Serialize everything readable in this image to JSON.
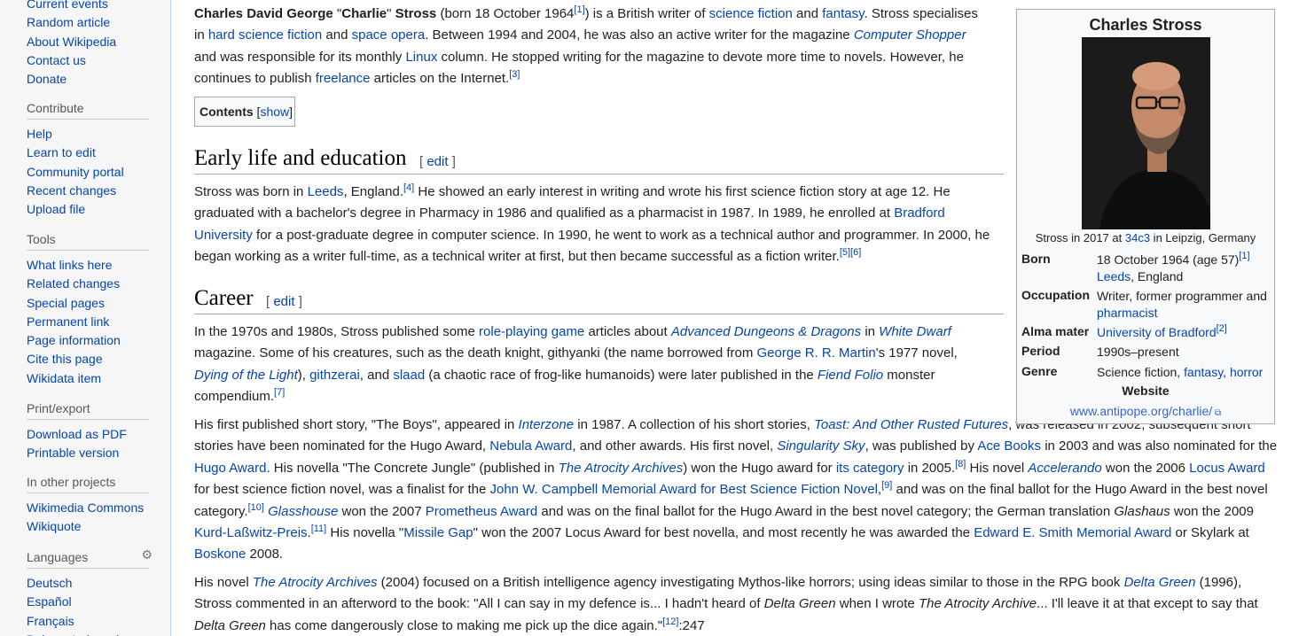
{
  "sidebar": {
    "nav_items": [
      "Current events",
      "Random article",
      "About Wikipedia",
      "Contact us",
      "Donate"
    ],
    "contribute": {
      "heading": "Contribute",
      "items": [
        "Help",
        "Learn to edit",
        "Community portal",
        "Recent changes",
        "Upload file"
      ]
    },
    "tools": {
      "heading": "Tools",
      "items": [
        "What links here",
        "Related changes",
        "Special pages",
        "Permanent link",
        "Page information",
        "Cite this page",
        "Wikidata item"
      ]
    },
    "print": {
      "heading": "Print/export",
      "items": [
        "Download as PDF",
        "Printable version"
      ]
    },
    "projects": {
      "heading": "In other projects",
      "items": [
        "Wikimedia Commons",
        "Wikiquote"
      ]
    },
    "languages": {
      "heading": "Languages",
      "items": [
        "Deutsch",
        "Español",
        "Français",
        "Bahasa Indonesia"
      ]
    }
  },
  "toc": {
    "label": "Contents",
    "show_label": "show"
  },
  "sections": {
    "early": {
      "title": "Early life and education",
      "edit": "edit"
    },
    "career": {
      "title": "Career",
      "edit": "edit"
    }
  },
  "infobox": {
    "title": "Charles Stross",
    "caption_pre": "Stross in 2017 at ",
    "caption_link": "34c3",
    "caption_post": " in Leipzig, Germany",
    "born_label": "Born",
    "born_date": "18 October 1964 (age 57)",
    "born_ref": "[1]",
    "born_place": "Leeds",
    "born_country": ", England",
    "occupation_label": "Occupation",
    "occupation_text": "Writer, former programmer and",
    "occupation_link": "pharmacist",
    "alma_label": "Alma mater",
    "alma_link": "University of Bradford",
    "alma_ref": "[2]",
    "period_label": "Period",
    "period_value": "1990s–present",
    "genre_label": "Genre",
    "genre_text": "Science fiction, ",
    "genre_link1": "fantasy",
    "genre_sep": ", ",
    "genre_link2": "horror",
    "website_label": "Website",
    "website_url": "www.antipope.org/charlie/"
  },
  "article": {
    "intro": [
      {
        "t": "b",
        "v": "Charles David George"
      },
      {
        "t": "x",
        "v": " \""
      },
      {
        "t": "b",
        "v": "Charlie"
      },
      {
        "t": "x",
        "v": "\" "
      },
      {
        "t": "b",
        "v": "Stross"
      },
      {
        "t": "x",
        "v": " (born 18 October 1964"
      },
      {
        "t": "r",
        "v": "[1]"
      },
      {
        "t": "x",
        "v": ") is a British writer of "
      },
      {
        "t": "a",
        "v": "science fiction"
      },
      {
        "t": "x",
        "v": " and "
      },
      {
        "t": "a",
        "v": "fantasy"
      },
      {
        "t": "x",
        "v": ". Stross specialises in "
      },
      {
        "t": "a",
        "v": "hard science fiction"
      },
      {
        "t": "x",
        "v": " and "
      },
      {
        "t": "a",
        "v": "space opera"
      },
      {
        "t": "x",
        "v": ". Between 1994 and 2004, he was also an active writer for the magazine "
      },
      {
        "t": "ai",
        "v": "Computer Shopper"
      },
      {
        "t": "x",
        "v": " and was responsible for its monthly "
      },
      {
        "t": "a",
        "v": "Linux"
      },
      {
        "t": "x",
        "v": " column. He stopped writing for the magazine to devote more time to novels. However, he continues to publish "
      },
      {
        "t": "a",
        "v": "freelance"
      },
      {
        "t": "x",
        "v": " articles on the Internet."
      },
      {
        "t": "r",
        "v": "[3]"
      }
    ],
    "early": [
      {
        "t": "x",
        "v": "Stross was born in "
      },
      {
        "t": "a",
        "v": "Leeds"
      },
      {
        "t": "x",
        "v": ", England."
      },
      {
        "t": "r",
        "v": "[4]"
      },
      {
        "t": "x",
        "v": " He showed an early interest in writing and wrote his first science fiction story at age 12. He graduated with a bachelor's degree in Pharmacy in 1986 and qualified as a pharmacist in 1987. In 1989, he enrolled at "
      },
      {
        "t": "a",
        "v": "Bradford University"
      },
      {
        "t": "x",
        "v": " for a post-graduate degree in computer science. In 1990, he went to work as a technical author and programmer. In 2000, he began working as a writer full-time, as a technical writer at first, but then became successful as a fiction writer."
      },
      {
        "t": "r",
        "v": "[5]"
      },
      {
        "t": "r",
        "v": "[6]"
      }
    ],
    "career1": [
      {
        "t": "x",
        "v": "In the 1970s and 1980s, Stross published some "
      },
      {
        "t": "a",
        "v": "role-playing game"
      },
      {
        "t": "x",
        "v": " articles about "
      },
      {
        "t": "ai",
        "v": "Advanced Dungeons & Dragons"
      },
      {
        "t": "x",
        "v": " in "
      },
      {
        "t": "ai",
        "v": "White Dwarf"
      },
      {
        "t": "x",
        "v": " magazine. Some of his creatures, such as the death knight, githyanki (the name borrowed from "
      },
      {
        "t": "a",
        "v": "George R. R. Martin"
      },
      {
        "t": "x",
        "v": "'s 1977 novel, "
      },
      {
        "t": "ai",
        "v": "Dying of the Light"
      },
      {
        "t": "x",
        "v": "), "
      },
      {
        "t": "a",
        "v": "githzerai"
      },
      {
        "t": "x",
        "v": ", and "
      },
      {
        "t": "a",
        "v": "slaad"
      },
      {
        "t": "x",
        "v": " (a chaotic race of frog-like humanoids) were later published in the "
      },
      {
        "t": "ai",
        "v": "Fiend Folio"
      },
      {
        "t": "x",
        "v": " monster compendium."
      },
      {
        "t": "r",
        "v": "[7]"
      }
    ],
    "career2": [
      {
        "t": "x",
        "v": "His first published short story, \"The Boys\", appeared in "
      },
      {
        "t": "ai",
        "v": "Interzone"
      },
      {
        "t": "x",
        "v": " in 1987. A collection of his short stories, "
      },
      {
        "t": "ai",
        "v": "Toast: And Other Rusted Futures"
      },
      {
        "t": "x",
        "v": ", was released in 2002; subsequent short stories have been nominated for the Hugo Award, "
      },
      {
        "t": "a",
        "v": "Nebula Award"
      },
      {
        "t": "x",
        "v": ", and other awards. His first novel, "
      },
      {
        "t": "ai",
        "v": "Singularity Sky"
      },
      {
        "t": "x",
        "v": ", was published by "
      },
      {
        "t": "a",
        "v": "Ace Books"
      },
      {
        "t": "x",
        "v": " in 2003 and was also nominated for the "
      },
      {
        "t": "a",
        "v": "Hugo Award"
      },
      {
        "t": "x",
        "v": ". His novella \"The Concrete Jungle\" (published in "
      },
      {
        "t": "ai",
        "v": "The Atrocity Archives"
      },
      {
        "t": "x",
        "v": ") won the Hugo award for "
      },
      {
        "t": "a",
        "v": "its category"
      },
      {
        "t": "x",
        "v": " in 2005."
      },
      {
        "t": "r",
        "v": "[8]"
      },
      {
        "t": "x",
        "v": " His novel "
      },
      {
        "t": "ai",
        "v": "Accelerando"
      },
      {
        "t": "x",
        "v": " won the 2006 "
      },
      {
        "t": "a",
        "v": "Locus Award"
      },
      {
        "t": "x",
        "v": " for best science fiction novel, was a finalist for the "
      },
      {
        "t": "a",
        "v": "John W. Campbell Memorial Award for Best Science Fiction Novel"
      },
      {
        "t": "x",
        "v": ","
      },
      {
        "t": "r",
        "v": "[9]"
      },
      {
        "t": "x",
        "v": " and was on the final ballot for the Hugo Award in the best novel category."
      },
      {
        "t": "r",
        "v": "[10]"
      },
      {
        "t": "x",
        "v": " "
      },
      {
        "t": "ai",
        "v": "Glasshouse"
      },
      {
        "t": "x",
        "v": " won the 2007 "
      },
      {
        "t": "a",
        "v": "Prometheus Award"
      },
      {
        "t": "x",
        "v": " and was on the final ballot for the Hugo Award in the best novel category; the German translation "
      },
      {
        "t": "i",
        "v": "Glashaus"
      },
      {
        "t": "x",
        "v": " won the 2009 "
      },
      {
        "t": "a",
        "v": "Kurd-Laßwitz-Preis"
      },
      {
        "t": "x",
        "v": "."
      },
      {
        "t": "r",
        "v": "[11]"
      },
      {
        "t": "x",
        "v": " His novella \""
      },
      {
        "t": "a",
        "v": "Missile Gap"
      },
      {
        "t": "x",
        "v": "\" won the 2007 Locus Award for best novella, and most recently he was awarded the "
      },
      {
        "t": "a",
        "v": "Edward E. Smith Memorial Award"
      },
      {
        "t": "x",
        "v": " or Skylark at "
      },
      {
        "t": "a",
        "v": "Boskone"
      },
      {
        "t": "x",
        "v": " 2008."
      }
    ],
    "career3": [
      {
        "t": "x",
        "v": "His novel "
      },
      {
        "t": "ai",
        "v": "The Atrocity Archives"
      },
      {
        "t": "x",
        "v": " (2004) focused on a British intelligence agency investigating Mythos-like horrors; using ideas similar to those in the RPG book "
      },
      {
        "t": "ai",
        "v": "Delta Green"
      },
      {
        "t": "x",
        "v": " (1996), Stross commented in an afterword to the book: \"All I can say in my defence is... I hadn't heard of "
      },
      {
        "t": "i",
        "v": "Delta Green"
      },
      {
        "t": "x",
        "v": " when I wrote "
      },
      {
        "t": "i",
        "v": "The Atrocity Archive"
      },
      {
        "t": "x",
        "v": "... I'll leave it at that except to say that "
      },
      {
        "t": "i",
        "v": "Delta Green"
      },
      {
        "t": "x",
        "v": " has come dangerously close to making me pick up the dice again.\""
      },
      {
        "t": "r",
        "v": "[12]"
      },
      {
        "t": "x",
        "v": ":247"
      }
    ]
  },
  "colors": {
    "link": "#0645ad",
    "sidebar_bg": "#f6f6f6",
    "border": "#a7d7f9",
    "infobox_bg": "#f8f9fa"
  }
}
